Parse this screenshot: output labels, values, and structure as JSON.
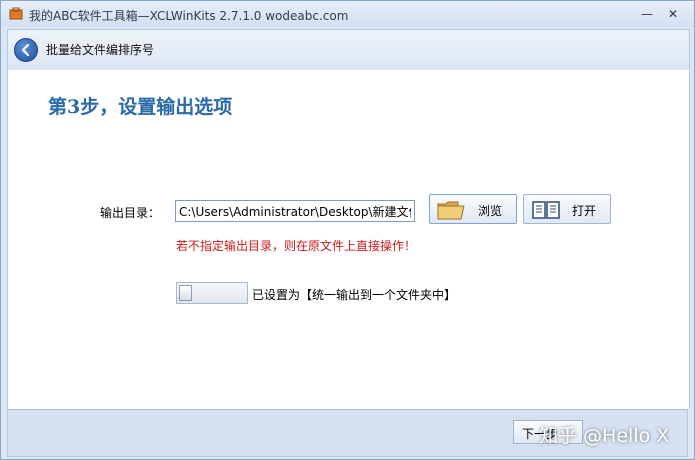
{
  "window": {
    "title": "我的ABC软件工具箱—XCLWinKits 2.7.1.0  wodeabc.com",
    "minimize_glyph": "—",
    "close_glyph": "✕"
  },
  "header": {
    "title": "批量给文件编排序号",
    "back_icon": "back-arrow-icon"
  },
  "main": {
    "step_title": "第3步，设置输出选项",
    "output_label": "输出目录：",
    "output_value": "C:\\Users\\Administrator\\Desktop\\新建文件",
    "browse_label": "浏览",
    "open_label": "打开",
    "warning": "若不指定输出目录，则在原文件上直接操作！",
    "toggle_label": "已设置为【统一输出到一个文件夹中】",
    "toggle_on": false
  },
  "footer": {
    "next_label": "下一步"
  },
  "watermark": "知乎 @Hello X",
  "colors": {
    "accent": "#2b6aa8",
    "warning": "#cc1a1a"
  }
}
